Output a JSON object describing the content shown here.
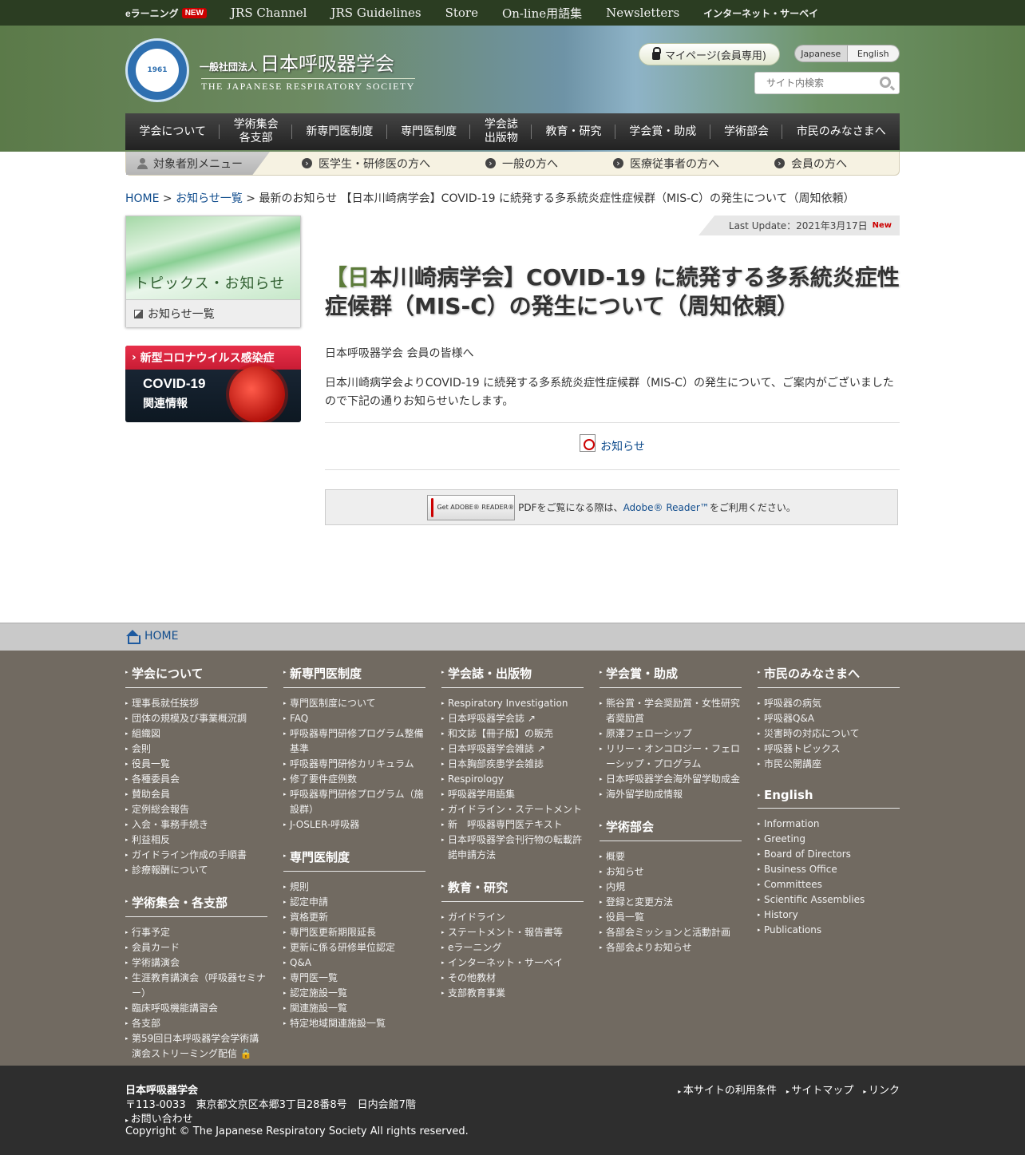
{
  "topbar": {
    "elearning": "eラーニング",
    "elearning_badge": "NEW",
    "items": [
      "JRS Channel",
      "JRS Guidelines",
      "Store",
      "On-line用語集",
      "Newsletters"
    ],
    "survey": "インターネット・サーベイ"
  },
  "header": {
    "logo_text": "1961",
    "org_prefix": "一般社団法人",
    "org_name": "日本呼吸器学会",
    "org_en": "THE JAPANESE RESPIRATORY SOCIETY",
    "mypage": "マイページ(会員専用)",
    "lang_ja": "Japanese",
    "lang_en": "English",
    "search_placeholder": "サイト内検索"
  },
  "gnav": [
    {
      "label": "学会について"
    },
    {
      "label": "学術集会\n各支部"
    },
    {
      "label": "新専門医制度"
    },
    {
      "label": "専門医制度"
    },
    {
      "label": "学会誌\n出版物"
    },
    {
      "label": "教育・研究"
    },
    {
      "label": "学会賞・助成"
    },
    {
      "label": "学術部会"
    },
    {
      "label": "市民のみなさまへ"
    }
  ],
  "submenu": {
    "label": "対象者別メニュー",
    "items": [
      "医学生・研修医の方へ",
      "一般の方へ",
      "医療従事者の方へ",
      "会員の方へ"
    ]
  },
  "breadcrumb": {
    "home": "HOME",
    "sep1": " > ",
    "news": "お知らせ一覧",
    "sep2": " > ",
    "current": "最新のお知らせ 【日本川崎病学会】COVID-19 に続発する多系統炎症性症候群（MIS-C）の発生について（周知依頼）"
  },
  "sidebar": {
    "heading": "トピックス・お知らせ",
    "link": "お知らせ一覧",
    "banner_top": "新型コロナウイルス感染症",
    "banner_main": "COVID-19",
    "banner_sub": "関連情報"
  },
  "content": {
    "last_update": "Last Update：2021年3月17日",
    "new_badge": "New",
    "title_bracket": "【日",
    "title_rest": "本川崎病学会】COVID-19 に続発する多系統炎症性症候群（MIS-C）の発生について（周知依頼）",
    "greeting": "日本呼吸器学会 会員の皆様へ",
    "body": "日本川崎病学会よりCOVID-19 に続発する多系統炎症性症候群（MIS-C）の発生について、ご案内がございましたので下記の通りお知らせいたします。",
    "attachment": "お知らせ",
    "reader_badge": "Get ADOBE® READER®",
    "reader_pre": "PDFをご覧になる際は、",
    "reader_link": "Adobe® Reader™",
    "reader_post": "をご利用ください。"
  },
  "footer_home": "HOME",
  "footer_cols": [
    {
      "sections": [
        {
          "title": "学会について",
          "items": [
            "理事長就任挨拶",
            "団体の規模及び事業概況調",
            "組織図",
            "会則",
            "役員一覧",
            "各種委員会",
            "賛助会員",
            "定例総会報告",
            "入会・事務手続き",
            "利益相反",
            "ガイドライン作成の手順書",
            "診療報酬について"
          ]
        },
        {
          "title": "学術集会・各支部",
          "items": [
            "行事予定",
            "会員カード",
            "学術講演会",
            "生涯教育講演会（呼吸器セミナー）",
            "臨床呼吸機能講習会",
            "各支部",
            "第59回日本呼吸器学会学術講演会ストリーミング配信 🔒"
          ]
        }
      ]
    },
    {
      "sections": [
        {
          "title": "新専門医制度",
          "items": [
            "専門医制度について",
            "FAQ",
            "呼吸器専門研修プログラム整備基準",
            "呼吸器専門研修カリキュラム",
            "修了要件症例数",
            "呼吸器専門研修プログラム（施設群）",
            "J-OSLER-呼吸器"
          ]
        },
        {
          "title": "専門医制度",
          "items": [
            "規則",
            "認定申請",
            "資格更新",
            "専門医更新期限延長",
            "更新に係る研修単位認定",
            "Q&A",
            "専門医一覧",
            "認定施設一覧",
            "関連施設一覧",
            "特定地域関連施設一覧"
          ]
        }
      ]
    },
    {
      "sections": [
        {
          "title": "学会誌・出版物",
          "items": [
            "Respiratory Investigation",
            "日本呼吸器学会誌 ↗",
            "和文誌【冊子版】の販売",
            "日本呼吸器学会雑誌 ↗",
            "日本胸部疾患学会雑誌",
            "Respirology",
            "呼吸器学用語集",
            "ガイドライン・ステートメント",
            "新　呼吸器専門医テキスト",
            "日本呼吸器学会刊行物の転載許諾申請方法"
          ]
        },
        {
          "title": "教育・研究",
          "items": [
            "ガイドライン",
            "ステートメント・報告書等",
            "eラーニング",
            "インターネット・サーベイ",
            "その他教材",
            "支部教育事業"
          ]
        }
      ]
    },
    {
      "sections": [
        {
          "title": "学会賞・助成",
          "items": [
            "熊谷賞・学会奨励賞・女性研究者奨励賞",
            "原澤フェローシップ",
            "リリー・オンコロジー・フェローシップ・プログラム",
            "日本呼吸器学会海外留学助成金",
            "海外留学助成情報"
          ]
        },
        {
          "title": "学術部会",
          "items": [
            "概要",
            "お知らせ",
            "内規",
            "登録と変更方法",
            "役員一覧",
            "各部会ミッションと活動計画",
            "各部会よりお知らせ"
          ]
        }
      ]
    },
    {
      "sections": [
        {
          "title": "市民のみなさまへ",
          "items": [
            "呼吸器の病気",
            "呼吸器Q&A",
            "災害時の対応について",
            "呼吸器トピックス",
            "市民公開講座"
          ]
        },
        {
          "title": "English",
          "items": [
            "Information",
            "Greeting",
            "Board of Directors",
            "Business Office",
            "Committees",
            "Scientific Assemblies",
            "History",
            "Publications"
          ]
        }
      ]
    }
  ],
  "footer_bottom": {
    "name": "日本呼吸器学会",
    "address": "〒113-0033　東京都文京区本郷3丁目28番8号　日内会館7階",
    "contact": "お問い合わせ",
    "copyright": "Copyright © The Japanese Respiratory Society All rights reserved.",
    "links": [
      "本サイトの利用条件",
      "サイトマップ",
      "リンク"
    ]
  }
}
